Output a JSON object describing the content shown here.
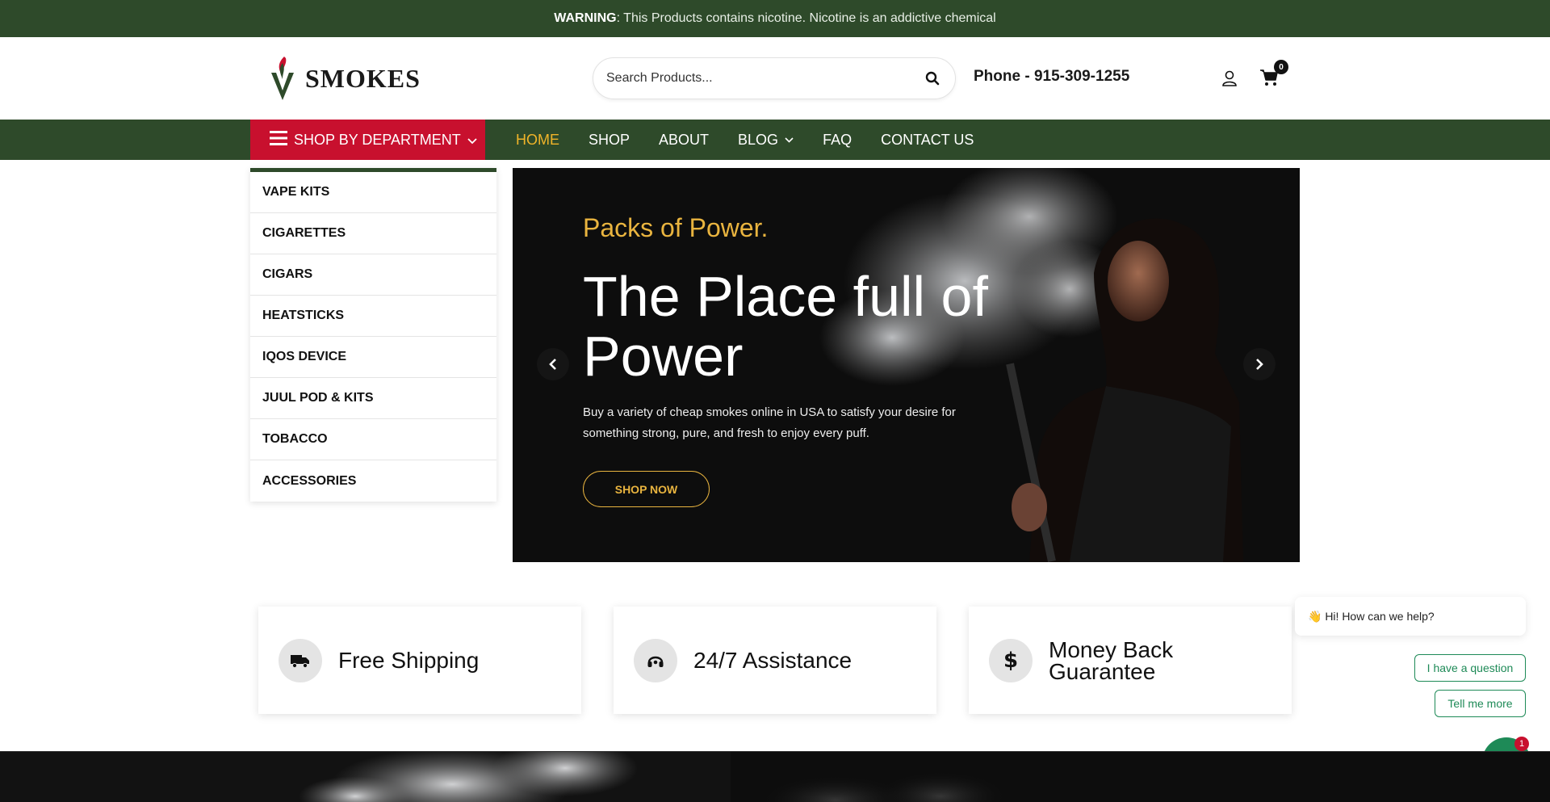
{
  "warning": {
    "strong": "WARNING",
    "text": ": This Products contains nicotine. Nicotine is an addictive chemical"
  },
  "logo": {
    "text": "SMOKES"
  },
  "search": {
    "placeholder": "Search Products..."
  },
  "phone": "Phone - 915-309-1255",
  "cart": {
    "count": "0"
  },
  "nav": {
    "department_label": "SHOP BY DEPARTMENT",
    "links": [
      {
        "label": "HOME",
        "active": true
      },
      {
        "label": "SHOP"
      },
      {
        "label": "ABOUT"
      },
      {
        "label": "BLOG",
        "dropdown": true
      },
      {
        "label": "FAQ"
      },
      {
        "label": "CONTACT US"
      }
    ]
  },
  "departments": [
    "VAPE KITS",
    "CIGARETTES",
    "CIGARS",
    "HEATSTICKS",
    "IQOS DEVICE",
    "JUUL POD & KITS",
    "TOBACCO",
    "ACCESSORIES"
  ],
  "hero": {
    "kicker": "Packs of Power.",
    "title": "The Place full of Power",
    "description": "Buy a variety of cheap smokes online in USA to satisfy your desire for something strong, pure, and fresh to enjoy every puff.",
    "button": "SHOP NOW"
  },
  "features": [
    {
      "icon": "truck-icon",
      "label": "Free Shipping"
    },
    {
      "icon": "headset-icon",
      "label": "24/7 Assistance"
    },
    {
      "icon": "dollar-icon",
      "label": "Money Back Guarantee"
    }
  ],
  "chat": {
    "greeting": "👋 Hi! How can we help?",
    "options": [
      "I have a question",
      "Tell me more"
    ],
    "badge": "1"
  },
  "colors": {
    "brand_green": "#2e4a2a",
    "brand_red": "#c8102e",
    "accent_gold": "#e9b43f",
    "chat_green": "#1e8a57"
  }
}
